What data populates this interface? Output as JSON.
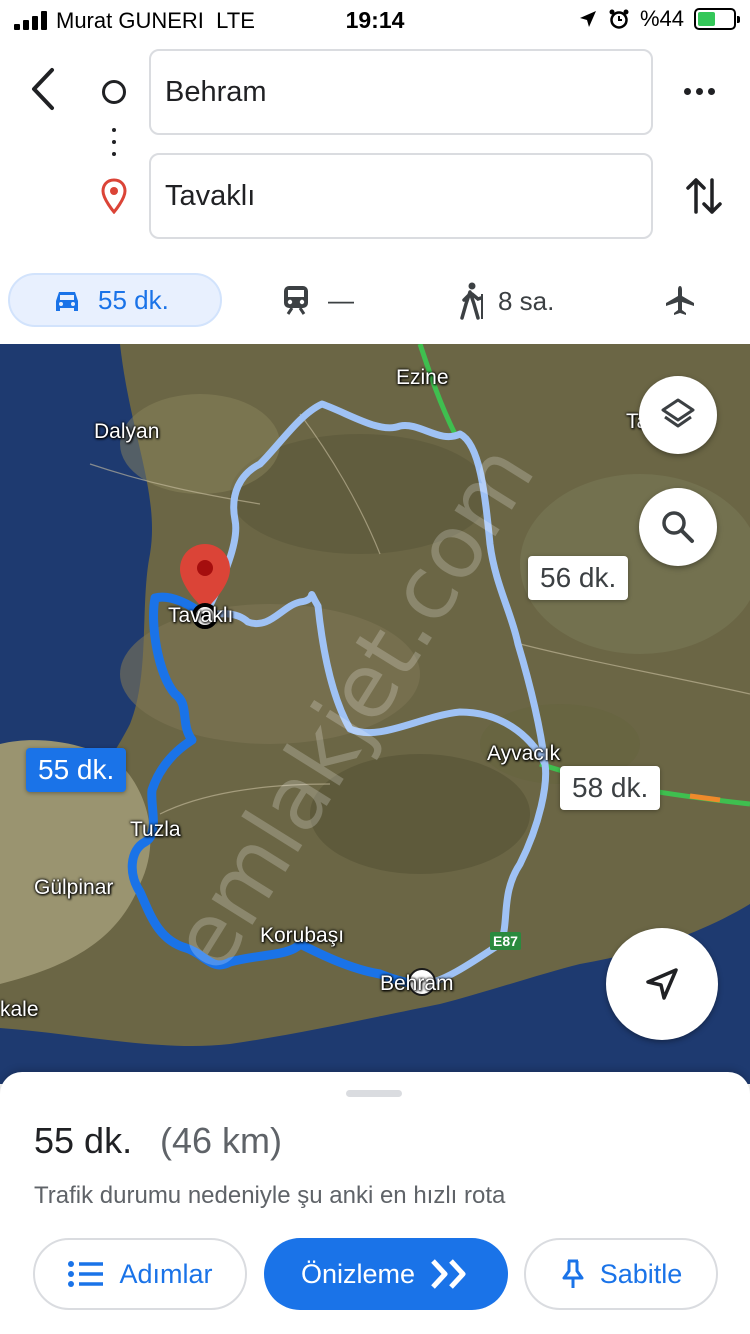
{
  "status_bar": {
    "carrier": "Murat GUNERI",
    "network": "LTE",
    "time": "19:14",
    "battery": "%44",
    "battery_level": 0.44
  },
  "directions": {
    "origin": "Behram",
    "destination": "Tavaklı"
  },
  "modes": {
    "car": "55 dk.",
    "transit": "—",
    "walk": "8 sa."
  },
  "map": {
    "places": {
      "ezine": "Ezine",
      "dalyan": "Dalyan",
      "tavakli": "Tavaklı",
      "ayvacik": "Ayvacık",
      "tuzla": "Tuzla",
      "gulpinar": "Gülpinar",
      "korubasi": "Korubaşı",
      "behram": "Behram",
      "kale": "kale",
      "right_edge": "Tavaklı"
    },
    "road_shield": "E87",
    "watermark": "emlakjet.com",
    "route_labels": {
      "selected": "55 dk.",
      "alt1": "56 dk.",
      "alt2": "58 dk."
    },
    "colors": {
      "route_selected": "#1a73e8",
      "route_alt": "#9fc2f5",
      "pin": "#db4437"
    }
  },
  "summary": {
    "time": "55 dk.",
    "distance": "(46 km)",
    "note": "Trafik durumu nedeniyle şu anki en hızlı rota"
  },
  "actions": {
    "steps": "Adımlar",
    "preview": "Önizleme",
    "pin": "Sabitle"
  }
}
